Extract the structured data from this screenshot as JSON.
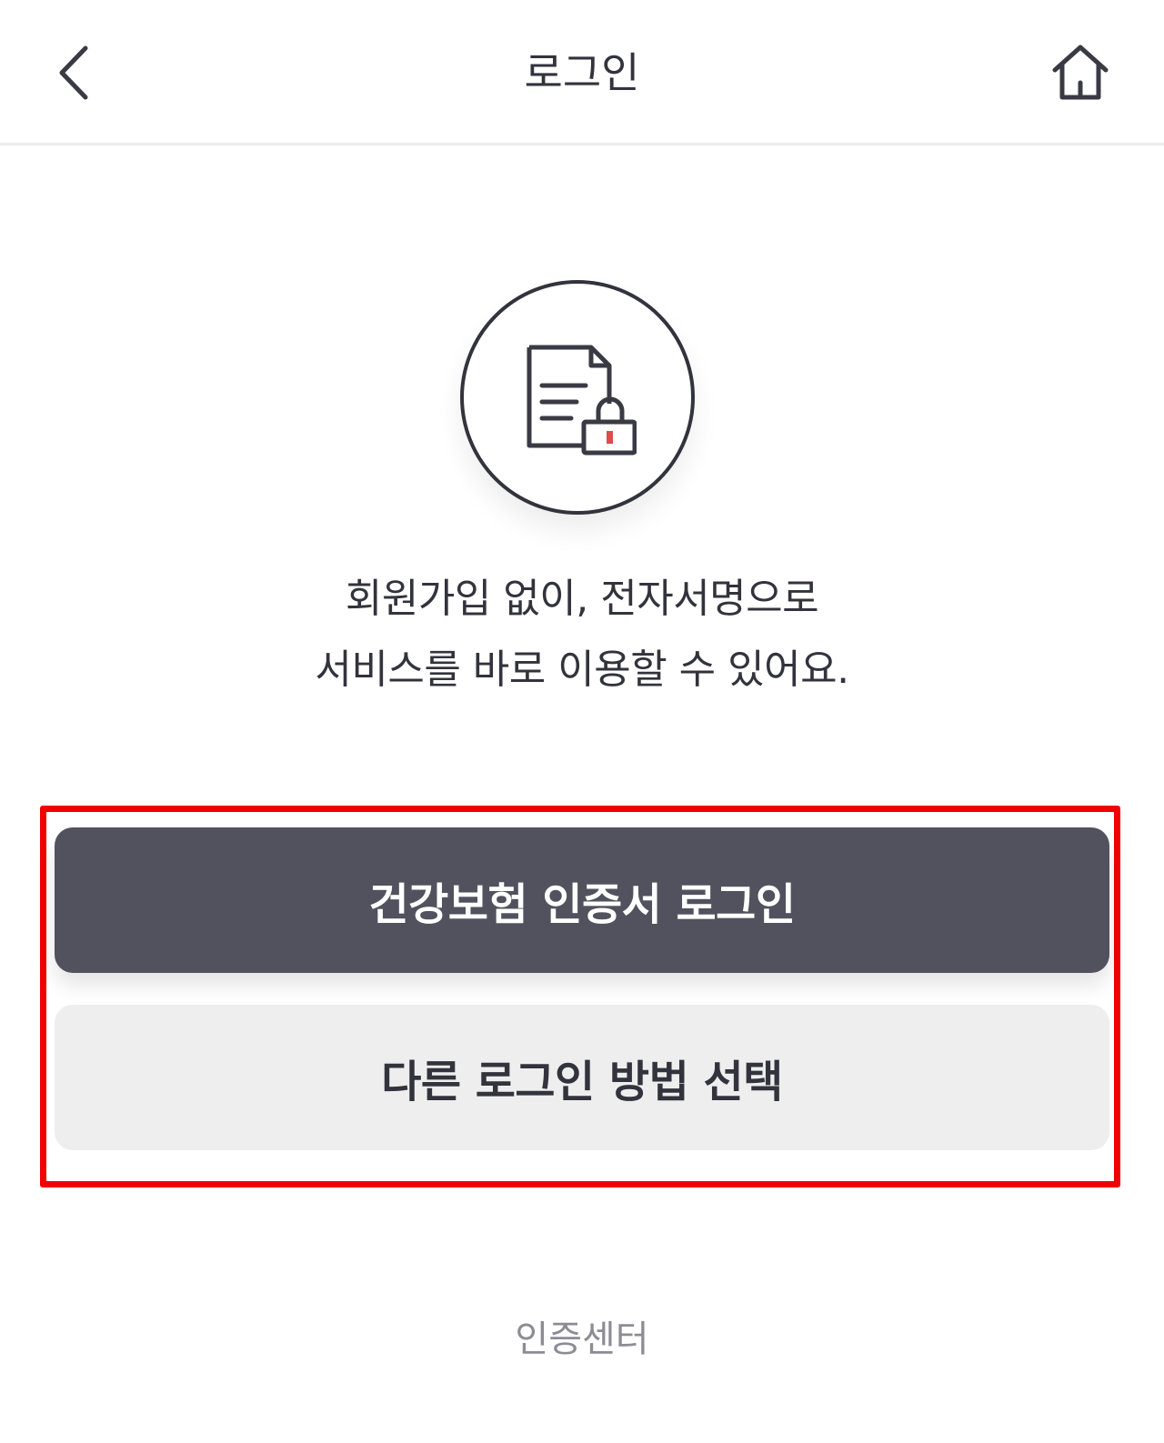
{
  "header": {
    "title": "로그인",
    "back_icon": "chevron-left-icon",
    "home_icon": "home-icon"
  },
  "hero": {
    "icon": "document-lock-icon",
    "line1": "회원가입 없이, 전자서명으로",
    "line2": "서비스를 바로 이용할 수 있어요."
  },
  "actions": {
    "primary_label": "건강보험 인증서 로그인",
    "secondary_label": "다른 로그인 방법 선택"
  },
  "footer": {
    "link_label": "인증센터"
  },
  "colors": {
    "primary_button": "#52525f",
    "secondary_button": "#eeeeee",
    "text": "#33333d",
    "highlight": "#f20000",
    "lock_accent": "#e04b4b"
  }
}
